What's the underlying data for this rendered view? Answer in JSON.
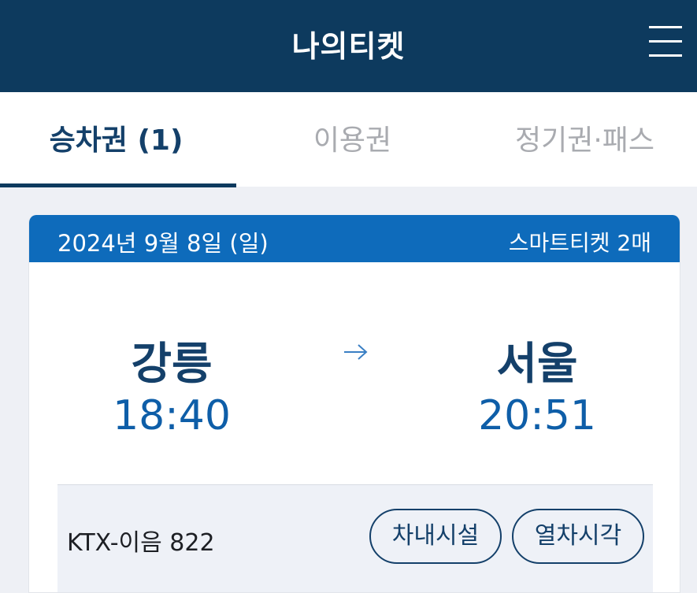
{
  "header": {
    "title": "나의티켓",
    "menu_icon": "hamburger-menu-icon"
  },
  "tabs": [
    {
      "label": "승차권 (1)",
      "active": true
    },
    {
      "label": "이용권",
      "active": false
    },
    {
      "label": "정기권·패스",
      "active": false
    }
  ],
  "ticket": {
    "date": "2024년 9월 8일 (일)",
    "type_count": "스마트티켓 2매",
    "departure": {
      "station": "강릉",
      "time": "18:40"
    },
    "arrival": {
      "station": "서울",
      "time": "20:51"
    },
    "arrow_icon": "arrow-right-icon",
    "train": "KTX-이음 822",
    "buttons": {
      "facilities": "차내시설",
      "timetable": "열차시각"
    }
  },
  "colors": {
    "header_bg": "#0d3a5e",
    "ticket_header_bg": "#0e6bbb",
    "station_text": "#14406a",
    "time_text": "#0e5ea8",
    "inactive_tab": "#a9abb0"
  }
}
